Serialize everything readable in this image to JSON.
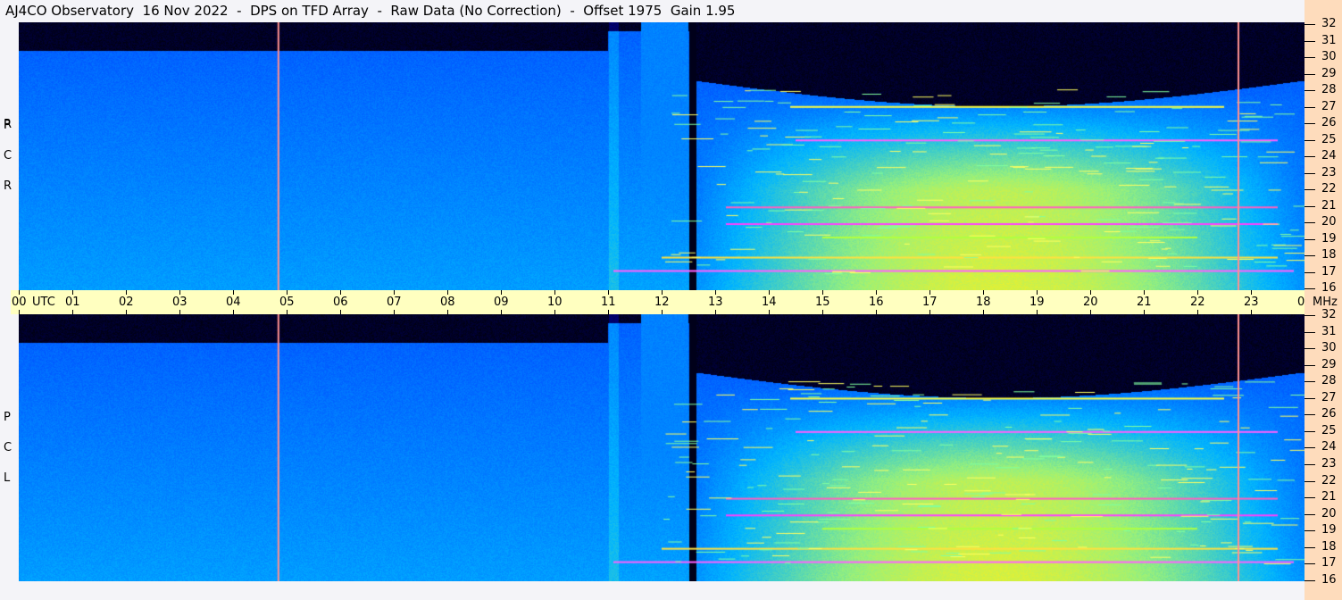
{
  "title": "AJ4CO Observatory  16 Nov 2022  -  DPS on TFD Array  -  Raw Data (No Correction)  -  Offset 1975  Gain 1.95",
  "colors": {
    "background": "#f4f4f8",
    "time_axis": "#ffffc0",
    "freq_axis": "#fedcbc",
    "marker": "#ff8080"
  },
  "chart_data": {
    "type": "heatmap",
    "title": "AJ4CO Observatory 16 Nov 2022 - DPS on TFD Array - Raw Data (No Correction) - Offset 1975 Gain 1.95",
    "xlabel": "UTC",
    "ylabel": "MHz",
    "x_unit_label": "UTC",
    "y_unit_label": "MHz",
    "xlim": [
      0,
      24
    ],
    "ylim": [
      16,
      32
    ],
    "x_ticks": [
      "00",
      "01",
      "02",
      "03",
      "04",
      "05",
      "06",
      "07",
      "08",
      "09",
      "10",
      "11",
      "12",
      "13",
      "14",
      "15",
      "16",
      "17",
      "18",
      "19",
      "20",
      "21",
      "22",
      "23",
      "00"
    ],
    "y_ticks": [
      "32",
      "31",
      "30",
      "29",
      "28",
      "27",
      "26",
      "25",
      "24",
      "23",
      "22",
      "21",
      "20",
      "19",
      "18",
      "17",
      "16"
    ],
    "panels": [
      {
        "name": "RCP",
        "letters": [
          "R",
          "C",
          "P"
        ]
      },
      {
        "name": "LCP",
        "letters": [
          "L",
          "C",
          "P"
        ]
      }
    ],
    "vertical_markers_utc": [
      4.83,
      22.75
    ],
    "persistent_signals_mhz": [
      27.0,
      25.0,
      21.0,
      20.0,
      18.0,
      17.2
    ],
    "ionospheric_opening_utc": [
      12.5,
      23.9
    ]
  }
}
